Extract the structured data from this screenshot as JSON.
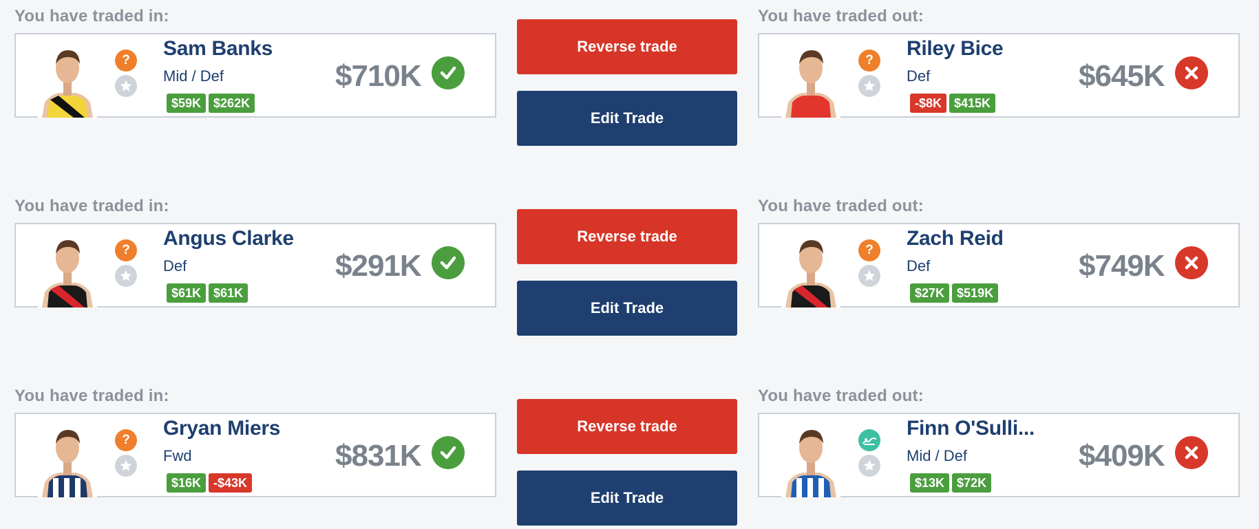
{
  "labels": {
    "traded_in": "You have traded in:",
    "traded_out": "You have traded out:"
  },
  "buttons": {
    "reverse": "Reverse trade",
    "edit": "Edit Trade"
  },
  "colors": {
    "positive": "#4a9e3d",
    "negative": "#d7382a",
    "check_green": "#4a9e3d",
    "cross_red": "#d7382a",
    "reverse_btn": "#d73527",
    "edit_btn": "#1e3f6f",
    "name_navy": "#1e3f6f",
    "status_orange": "#ef7f2a",
    "status_teal": "#3dbfa2"
  },
  "trades": [
    {
      "in": {
        "name": "Sam Banks",
        "position": "Mid / Def",
        "price": "$710K",
        "status_icon": "question-icon",
        "guernsey": "richmond",
        "tags": [
          {
            "text": "$59K",
            "sign": "positive"
          },
          {
            "text": "$262K",
            "sign": "positive"
          }
        ],
        "status": "check-icon"
      },
      "out": {
        "name": "Riley Bice",
        "position": "Def",
        "price": "$645K",
        "status_icon": "question-icon",
        "guernsey": "sydney",
        "tags": [
          {
            "text": "-$8K",
            "sign": "negative"
          },
          {
            "text": "$415K",
            "sign": "positive"
          }
        ],
        "status": "cross-icon"
      }
    },
    {
      "in": {
        "name": "Angus Clarke",
        "position": "Def",
        "price": "$291K",
        "status_icon": "question-icon",
        "guernsey": "essendon",
        "tags": [
          {
            "text": "$61K",
            "sign": "positive"
          },
          {
            "text": "$61K",
            "sign": "positive"
          }
        ],
        "status": "check-icon"
      },
      "out": {
        "name": "Zach Reid",
        "position": "Def",
        "price": "$749K",
        "status_icon": "question-icon",
        "guernsey": "essendon",
        "tags": [
          {
            "text": "$27K",
            "sign": "positive"
          },
          {
            "text": "$519K",
            "sign": "positive"
          }
        ],
        "status": "cross-icon"
      }
    },
    {
      "in": {
        "name": "Gryan Miers",
        "position": "Fwd",
        "price": "$831K",
        "status_icon": "question-icon",
        "guernsey": "geelong",
        "tags": [
          {
            "text": "$16K",
            "sign": "positive"
          },
          {
            "text": "-$43K",
            "sign": "negative"
          }
        ],
        "status": "check-icon"
      },
      "out": {
        "name": "Finn O'Sulli...",
        "position": "Mid / Def",
        "price": "$409K",
        "status_icon": "bye-icon",
        "guernsey": "northmelbourne",
        "tags": [
          {
            "text": "$13K",
            "sign": "positive"
          },
          {
            "text": "$72K",
            "sign": "positive"
          }
        ],
        "status": "cross-icon"
      }
    }
  ]
}
